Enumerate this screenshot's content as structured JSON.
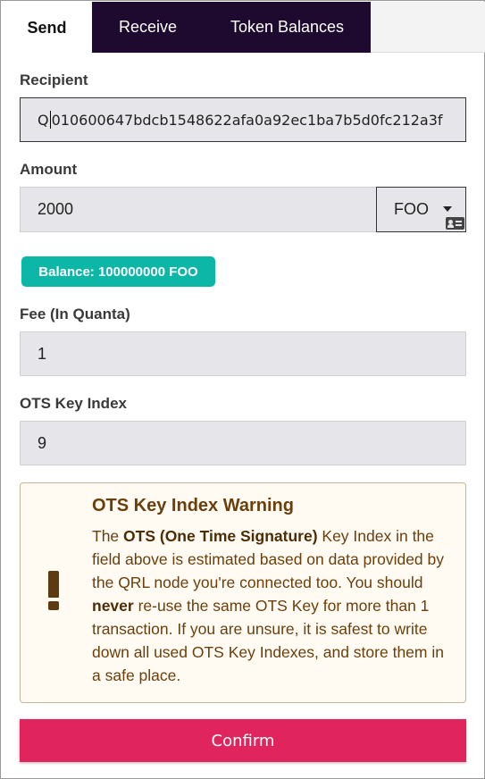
{
  "tabs": [
    {
      "label": "Send",
      "active": true
    },
    {
      "label": "Receive",
      "active": false
    },
    {
      "label": "Token Balances",
      "active": false
    }
  ],
  "recipient": {
    "label": "Recipient",
    "value_prefix": "Q",
    "value_rest": "010600647bdcb1548622afa0a92ec1ba7b5d0fc212a3f"
  },
  "amount": {
    "label": "Amount",
    "value": "2000",
    "token": "FOO"
  },
  "balance": {
    "text": "Balance: 100000000 FOO"
  },
  "fee": {
    "label": "Fee (In Quanta)",
    "value": "1"
  },
  "ots": {
    "label": "OTS Key Index",
    "value": "9"
  },
  "warning": {
    "title": "OTS Key Index Warning",
    "part1": "The ",
    "bold1": "OTS (One Time Signature)",
    "part2": " Key Index in the field above is estimated based on data provided by the QRL node you're connected too. You should ",
    "bold2": "never",
    "part3": " re-use the same OTS Key for more than 1 transaction. If you are unsure, it is safest to write down all used OTS Key Indexes, and store them in a safe place."
  },
  "confirm_label": "Confirm",
  "colors": {
    "tab_dark": "#1d0a2e",
    "balance_badge": "#0db7a8",
    "confirm": "#e0245e",
    "warning_text": "#6b3f0c"
  },
  "icons": {
    "dropdown": "chevron-down-icon",
    "address_book": "address-card-icon",
    "warning": "exclamation-icon"
  }
}
